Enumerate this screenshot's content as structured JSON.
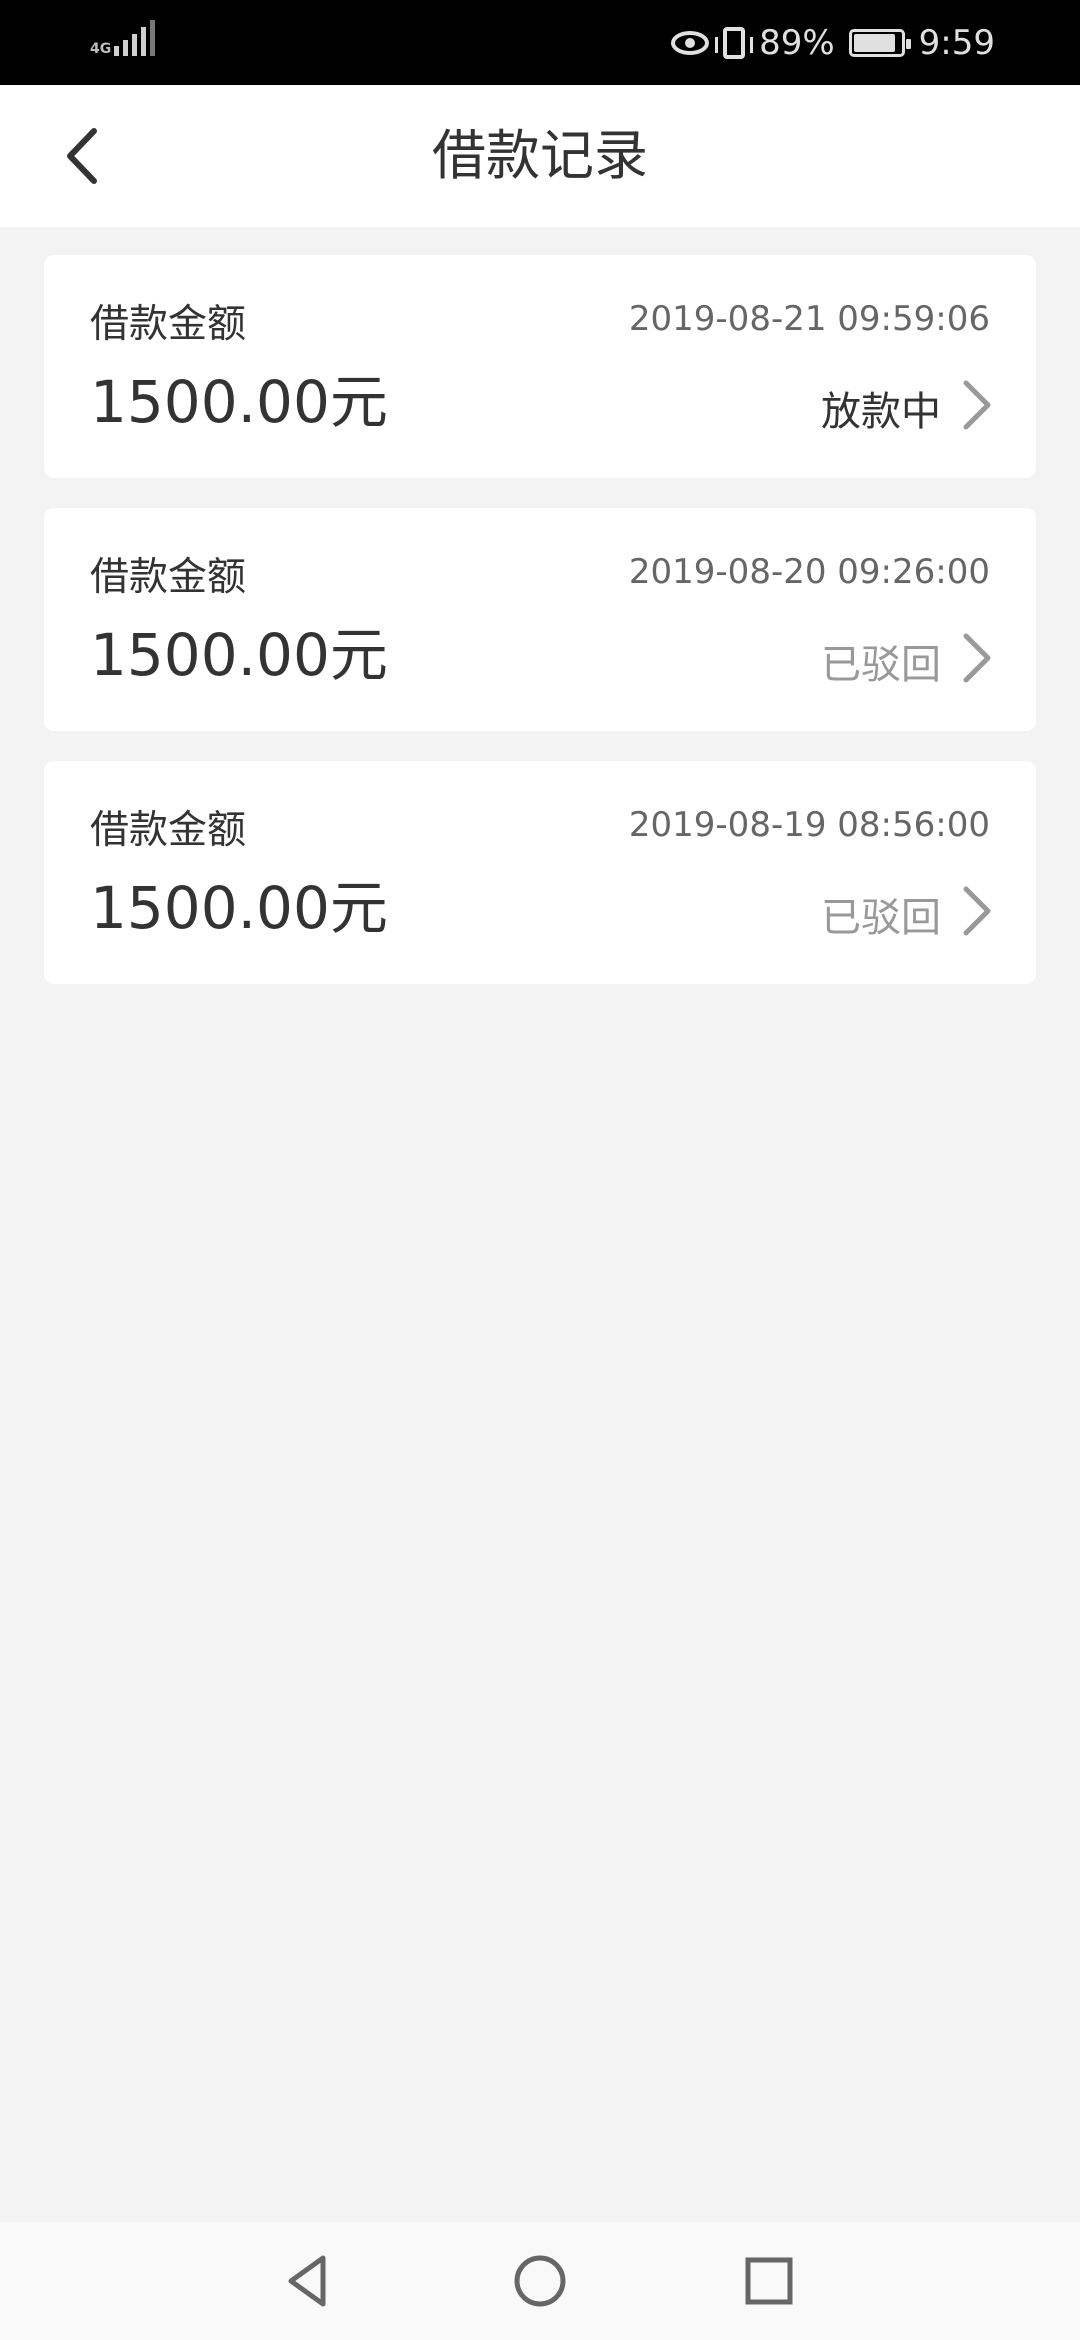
{
  "status_bar": {
    "network": "4G",
    "battery": "89%",
    "battery_level": 0.89,
    "time": "9:59"
  },
  "header": {
    "title": "借款记录",
    "back_icon": "chevron-left-icon"
  },
  "records": [
    {
      "label": "借款金额",
      "amount": "1500.00元",
      "time": "2019-08-21 09:59:06",
      "status": "放款中",
      "status_color": "#333333"
    },
    {
      "label": "借款金额",
      "amount": "1500.00元",
      "time": "2019-08-20 09:26:00",
      "status": "已驳回",
      "status_color": "#999999"
    },
    {
      "label": "借款金额",
      "amount": "1500.00元",
      "time": "2019-08-19 08:56:00",
      "status": "已驳回",
      "status_color": "#999999"
    }
  ],
  "nav_bar": {
    "icons": [
      "triangle-back-icon",
      "circle-home-icon",
      "square-recents-icon"
    ]
  }
}
